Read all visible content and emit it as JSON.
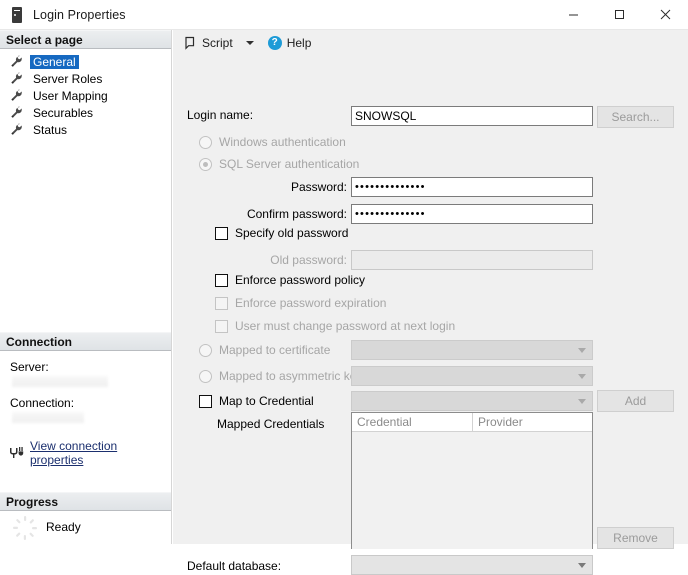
{
  "window": {
    "title": "Login Properties",
    "icon": "server-icon",
    "minimize_label": "Minimize",
    "maximize_label": "Maximize",
    "close_label": "Close"
  },
  "toolbar": {
    "script_label": "Script",
    "script_icon": "script-icon",
    "dropdown_icon": "chevron-down-icon",
    "help_label": "Help",
    "help_icon": "help-circle-icon"
  },
  "sidebar": {
    "select_page_header": "Select a page",
    "items": [
      {
        "label": "General",
        "selected": true
      },
      {
        "label": "Server Roles",
        "selected": false
      },
      {
        "label": "User Mapping",
        "selected": false
      },
      {
        "label": "Securables",
        "selected": false
      },
      {
        "label": "Status",
        "selected": false
      }
    ],
    "connection": {
      "header": "Connection",
      "server_label": "Server:",
      "server_value": "",
      "connection_label": "Connection:",
      "connection_value": "",
      "view_properties_link": "View connection properties",
      "link_icon": "connection-plug-icon"
    },
    "progress": {
      "header": "Progress",
      "status": "Ready",
      "icon": "spinner-icon"
    }
  },
  "main": {
    "login_name_label": "Login name:",
    "login_name_value": "SNOWSQL",
    "search_button": "Search...",
    "windows_auth_label": "Windows authentication",
    "sql_auth_label": "SQL Server authentication",
    "password_label": "Password:",
    "password_value": "••••••••••••••",
    "confirm_password_label": "Confirm password:",
    "confirm_password_value": "••••••••••••••",
    "specify_old_password_label": "Specify old password",
    "old_password_label": "Old password:",
    "old_password_value": "",
    "enforce_policy_label": "Enforce password policy",
    "enforce_expiration_label": "Enforce password expiration",
    "must_change_label": "User must change password at next login",
    "mapped_certificate_label": "Mapped to certificate",
    "mapped_certificate_value": "",
    "mapped_asymmetric_label": "Mapped to asymmetric key",
    "mapped_asymmetric_value": "",
    "map_credential_label": "Map to Credential",
    "map_credential_value": "",
    "add_button": "Add",
    "mapped_credentials_label": "Mapped Credentials",
    "credentials_grid": {
      "columns": [
        "Credential",
        "Provider"
      ],
      "rows": []
    },
    "remove_button": "Remove",
    "default_database_label": "Default database:",
    "default_database_value": ""
  },
  "colors": {
    "selection_blue": "#1669c1",
    "help_blue": "#1e9bd7",
    "link_navy": "#1b2f6e",
    "panel_grey": "#f0f0f0"
  }
}
